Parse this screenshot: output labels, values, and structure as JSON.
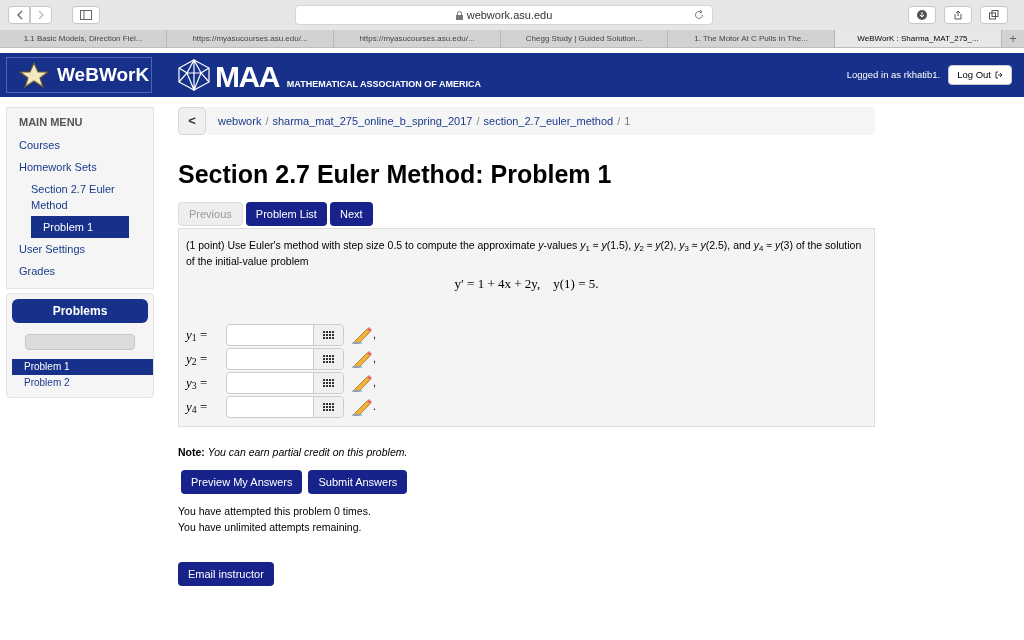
{
  "browser": {
    "address": "webwork.asu.edu",
    "tabs": [
      {
        "label": "1.1 Basic Models, Direction Fiel...",
        "selected": false
      },
      {
        "label": "https://myasucourses.asu.edu/...",
        "selected": false
      },
      {
        "label": "https://myasucourses.asu.edu/...",
        "selected": false
      },
      {
        "label": "Chegg Study | Guided Solution...",
        "selected": false
      },
      {
        "label": "1. The Motor At C Pulls In The...",
        "selected": false
      },
      {
        "label": "WeBWorK : Sharma_MAT_275_...",
        "selected": true
      }
    ],
    "new_tab": "+"
  },
  "header": {
    "logo": "WeBWorK",
    "maa_logo": "MAA",
    "maa_name": "MATHEMATICAL ASSOCIATION OF AMERICA",
    "login_text": "Logged in as rkhatib1.",
    "logout": "Log Out"
  },
  "sidebar": {
    "heading": "MAIN MENU",
    "items": [
      {
        "label": "Courses",
        "selected": false
      },
      {
        "label": "Homework Sets",
        "selected": false,
        "children": [
          {
            "label": "Section 2.7 Euler Method",
            "selected": false,
            "children": [
              {
                "label": "Problem 1",
                "selected": true
              }
            ]
          }
        ]
      },
      {
        "label": "User Settings",
        "selected": false
      },
      {
        "label": "Grades",
        "selected": false
      }
    ]
  },
  "problems_panel": {
    "title": "Problems",
    "items": [
      {
        "label": "Problem 1",
        "selected": true
      },
      {
        "label": "Problem 2",
        "selected": false
      }
    ]
  },
  "breadcrumb": {
    "back": "<",
    "separator": "/",
    "parts": [
      "webwork",
      "sharma_mat_275_online_b_spring_2017",
      "section_2.7_euler_method",
      "1"
    ]
  },
  "title": "Section 2.7 Euler Method: Problem 1",
  "nav_buttons": [
    {
      "label": "Previous",
      "disabled": true
    },
    {
      "label": "Problem List",
      "disabled": false
    },
    {
      "label": "Next",
      "disabled": false
    }
  ],
  "problem": {
    "text": "(1 point) Use Euler's method with step size 0.5 to compute the approximate *y*-values *y*$_{1}$ ≈ *y*(1.5), *y*$_{2}$ ≈ *y*(2), *y*$_{3}$ ≈ *y*(2.5), and *y*$_{4}$ ≈ *y*(3) of the solution of the initial-value problem",
    "equation": "y′ = 1 + 4x + 2y,    y(1) = 5.",
    "answers": [
      {
        "label": "*y*$_{1}$ =",
        "punct": ","
      },
      {
        "label": "*y*$_{2}$ =",
        "punct": ","
      },
      {
        "label": "*y*$_{3}$ =",
        "punct": ","
      },
      {
        "label": "*y*$_{4}$ =",
        "punct": "."
      }
    ]
  },
  "note": "**Note:** *You can earn partial credit on this problem.*",
  "action_buttons": [
    "Preview My Answers",
    "Submit Answers"
  ],
  "attempts": [
    "You have attempted this problem 0 times.",
    "You have unlimited attempts remaining."
  ],
  "email_button": "Email instructor"
}
